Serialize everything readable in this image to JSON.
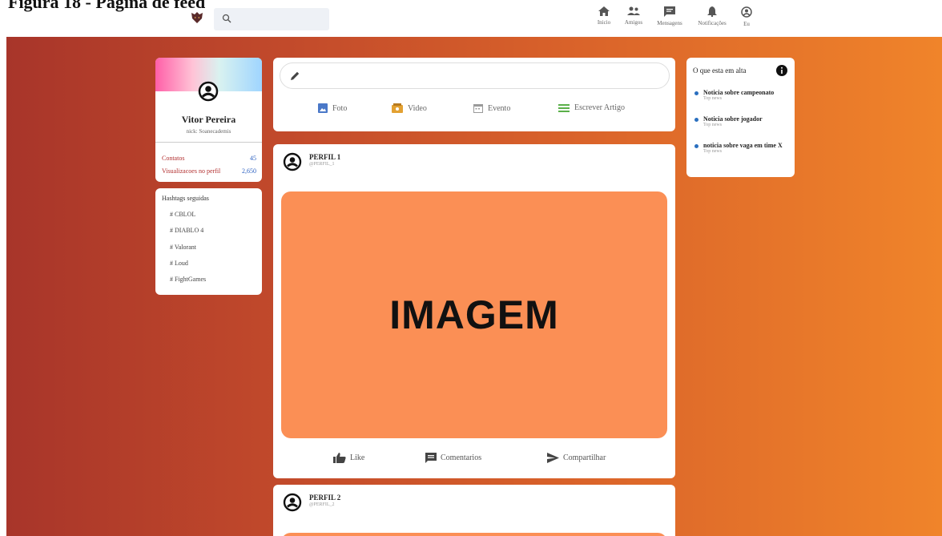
{
  "caption": "Figura 18 - Página de feed",
  "nav": {
    "items": [
      {
        "label": "Inicio",
        "icon": "home-icon"
      },
      {
        "label": "Amigos",
        "icon": "friends-icon"
      },
      {
        "label": "Mensagens",
        "icon": "message-icon"
      },
      {
        "label": "Notificações",
        "icon": "bell-icon"
      },
      {
        "label": "Eu",
        "icon": "account-icon"
      }
    ]
  },
  "search": {
    "placeholder": ""
  },
  "profile": {
    "name": "Vitor Pereira",
    "nick": "nick: Soanecademis",
    "stats": [
      {
        "label": "Contatos",
        "value": "45"
      },
      {
        "label": "Visualizacoes no perfil",
        "value": "2,650"
      }
    ]
  },
  "hashtags": {
    "title": "Hashtags seguidas",
    "items": [
      "CBLOL",
      "DIABLO 4",
      "Valorant",
      "Loud",
      "FightGames"
    ]
  },
  "composer": {
    "actions": [
      {
        "label": "Foto",
        "icon": "photo-icon",
        "color": "#4a78c8"
      },
      {
        "label": "Video",
        "icon": "video-icon",
        "color": "#e3a132"
      },
      {
        "label": "Evento",
        "icon": "calendar-icon",
        "color": "#9a9a9a"
      },
      {
        "label": "Escrever Artigo",
        "icon": "article-icon",
        "color": "#5bb04a"
      }
    ]
  },
  "posts": [
    {
      "title": "PERFIL 1",
      "handle": "@PERFIL_1",
      "image_text": "IMAGEM"
    },
    {
      "title": "PERFIL 2",
      "handle": "@PERFIL_2"
    }
  ],
  "post_actions": [
    {
      "label": "Like",
      "icon": "like-icon"
    },
    {
      "label": "Comentarios",
      "icon": "comment-icon"
    },
    {
      "label": "Compartilhar",
      "icon": "share-icon"
    }
  ],
  "trending": {
    "title": "O que esta em alta",
    "items": [
      {
        "title": "Noticia sobre campeonato",
        "source": "Top news"
      },
      {
        "title": "Noticia sobre jogador",
        "source": "Top news"
      },
      {
        "title": "noticia sobre vaga em time X",
        "source": "Top news"
      }
    ]
  },
  "colors": {
    "accent": "#f0842a",
    "image": "#fb8f55",
    "link": "#2a5fc0",
    "stat_label": "#b23030"
  }
}
